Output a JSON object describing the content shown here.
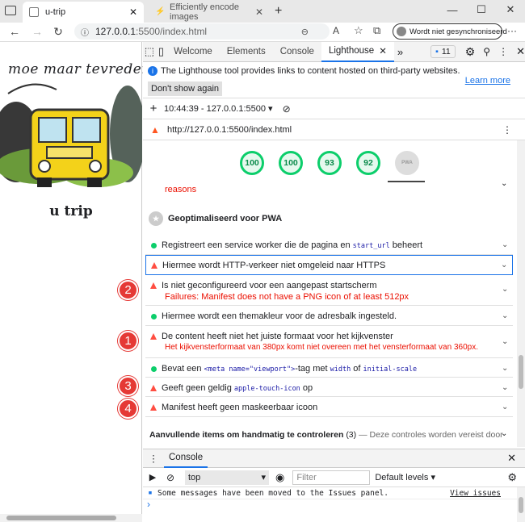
{
  "browser": {
    "tabs": [
      {
        "label": "u-trip",
        "active": true
      },
      {
        "label": "Efficiently encode images",
        "active": false
      }
    ],
    "new_tab": "+",
    "url_host": "127.0.0.1",
    "url_rest": ":5500/index.html",
    "sync_label": "Wordt niet gesynchroniseerd",
    "more": "···"
  },
  "page": {
    "logo_text": "moe maar tevreden",
    "title": "u trip"
  },
  "devtools": {
    "tabs": [
      "Welcome",
      "Elements",
      "Console",
      "Lighthouse"
    ],
    "more_tabs": "»",
    "issues_count": "11",
    "info_text": "The Lighthouse tool provides links to content hosted on third-party websites.",
    "learn_more": "Learn more",
    "dont_show": "Don't show again",
    "run_time": "10:44:39 - 127.0.0.1:5500",
    "audit_url": "http://127.0.0.1:5500/index.html",
    "scores": [
      "100",
      "100",
      "93",
      "92"
    ],
    "pwa_label": "PWA",
    "reasons": "reasons",
    "section_title": "Geoptimaliseerd voor PWA",
    "audits": {
      "a1_pre": "Registreert een service worker die de pagina en",
      "a1_code": "start_url",
      "a1_post": "beheert",
      "a2": "Hiermee wordt HTTP-verkeer niet omgeleid naar HTTPS",
      "a3": "Is niet geconfigureerd voor een aangepast startscherm",
      "a3_fail": "Failures: Manifest does not have a PNG icon of at least 512px",
      "a4": "Hiermee wordt een themakleur voor de adresbalk ingesteld.",
      "a5": "De content heeft niet het juiste formaat voor het kijkvenster",
      "a5_fail": "Het kijkvensterformaat van 380px komt niet overeen met het vensterformaat van 360px.",
      "a6_pre": "Bevat een",
      "a6_code1": "<meta name=\"viewport\">",
      "a6_mid": "-tag met",
      "a6_code2": "width",
      "a6_of": "of",
      "a6_code3": "initial-scale",
      "a7_pre": "Geeft geen geldig",
      "a7_code": "apple-touch-icon",
      "a7_post": "op",
      "a8": "Manifest heeft geen maskeerbaar icoon"
    },
    "manual_title": "Aanvullende items om handmatig te controleren",
    "manual_count": "(3)",
    "manual_desc": "— Deze controles worden vereist door de"
  },
  "badges": [
    "2",
    "1",
    "3",
    "4"
  ],
  "console": {
    "title": "Console",
    "context": "top",
    "filter_placeholder": "Filter",
    "levels": "Default levels",
    "message": "Some messages have been moved to the Issues panel.",
    "view_issues": "View issues",
    "prompt": "›"
  },
  "colors": {
    "accent": "#1a73e8",
    "pass": "#0cce6b",
    "fail": "#ff4e42",
    "badge": "#e53935"
  }
}
